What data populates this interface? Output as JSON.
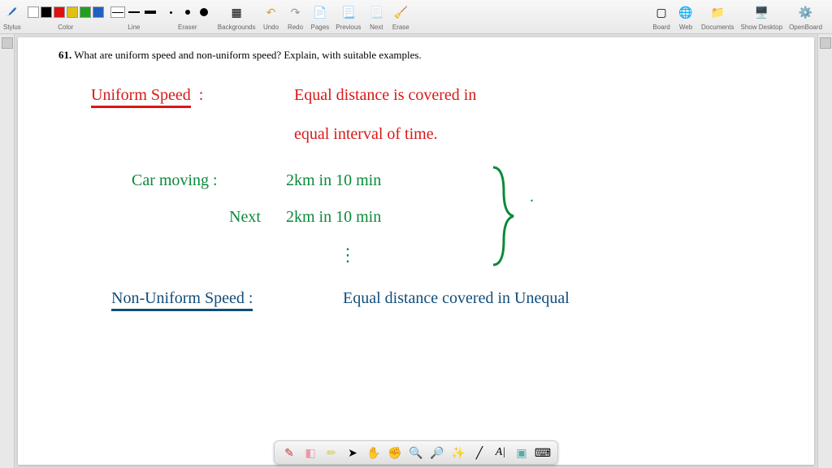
{
  "toolbar": {
    "stylus_label": "Stylus",
    "color_label": "Color",
    "line_label": "Line",
    "eraser_label": "Eraser",
    "backgrounds_label": "Backgrounds",
    "undo_label": "Undo",
    "redo_label": "Redo",
    "pages_label": "Pages",
    "previous_label": "Previous",
    "next_label": "Next",
    "erase_label": "Erase",
    "board_label": "Board",
    "web_label": "Web",
    "documents_label": "Documents",
    "show_desktop_label": "Show Desktop",
    "openboard_label": "OpenBoard",
    "colors": [
      "#ffffff",
      "#000000",
      "#e01010",
      "#e0c010",
      "#20a020",
      "#2060c0"
    ]
  },
  "question": {
    "number": "61.",
    "text": "What are uniform speed and non-uniform speed? Explain, with suitable examples."
  },
  "handwriting": {
    "uniform_speed": "Uniform Speed",
    "uniform_def_l1": "Equal   distance   is    covered   in",
    "uniform_def_l2": "equal  interval  of   time.",
    "car_moving": "Car moving :",
    "car_l1": "2km   in   10 min",
    "car_next": "Next",
    "car_l2": "2km   in   10 min",
    "dots": "⋮",
    "nonuniform": "Non-Uniform Speed :",
    "nonuniform_def": "Equal   distance  covered  in  Unequal"
  }
}
